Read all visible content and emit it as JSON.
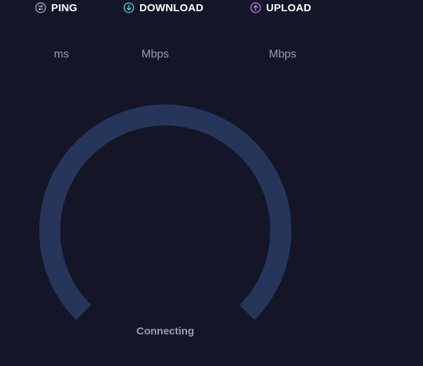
{
  "metrics": {
    "ping": {
      "label": "PING",
      "unit": "ms",
      "icon": "ping-icon",
      "color": "#a7abbe"
    },
    "download": {
      "label": "DOWNLOAD",
      "unit": "Mbps",
      "icon": "download-icon",
      "color": "#4fd1c5"
    },
    "upload": {
      "label": "UPLOAD",
      "unit": "Mbps",
      "icon": "upload-icon",
      "color": "#b77cf0"
    }
  },
  "gauge": {
    "status": "Connecting",
    "track_color": "#26365a",
    "background_color": "#141628"
  }
}
